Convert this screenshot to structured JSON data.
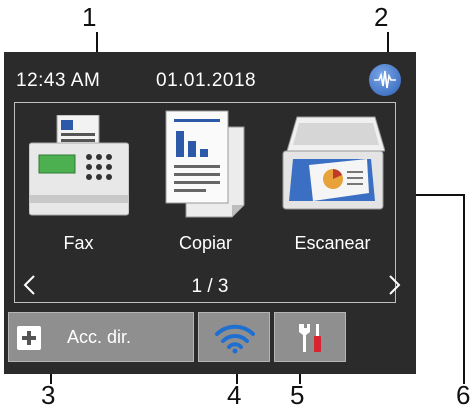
{
  "callouts": [
    "1",
    "2",
    "3",
    "4",
    "5",
    "6"
  ],
  "status": {
    "time": "12:43 AM",
    "date": "01.01.2018"
  },
  "tiles": [
    {
      "label": "Fax",
      "icon": "fax-icon"
    },
    {
      "label": "Copiar",
      "icon": "copy-icon"
    },
    {
      "label": "Escanear",
      "icon": "scan-icon"
    }
  ],
  "pager": {
    "text": "1 / 3"
  },
  "bottom": {
    "shortcut_label": "Acc. dir."
  },
  "colors": {
    "screen_bg": "#2b2b2b",
    "button_gray": "#8f8f8f",
    "wifi_blue": "#1e6fd0",
    "tool_red": "#d9232e"
  }
}
